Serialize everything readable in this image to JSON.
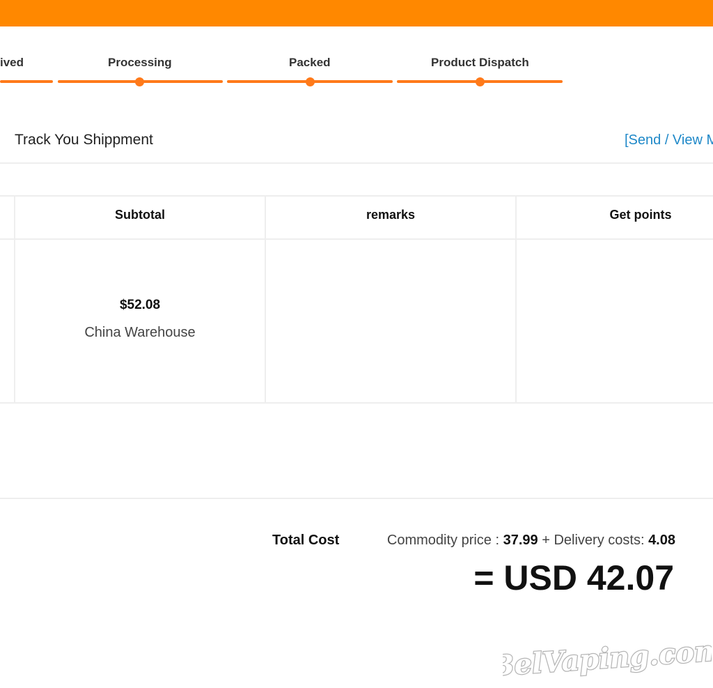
{
  "colors": {
    "accent": "#ff8800",
    "link": "#1e88c8"
  },
  "progress": {
    "steps": [
      {
        "label": "ived"
      },
      {
        "label": "Processing"
      },
      {
        "label": "Packed"
      },
      {
        "label": "Product Dispatch"
      }
    ]
  },
  "tracking": {
    "title": "Track You Shippment",
    "link_label": "[Send / View M"
  },
  "table": {
    "headers": [
      "Subtotal",
      "remarks",
      "Get points"
    ],
    "row": {
      "subtotal": "$52.08",
      "warehouse": "China Warehouse",
      "remarks": "",
      "points": ""
    }
  },
  "summary": {
    "label": "Total Cost",
    "commodity_label": "Commodity price :",
    "commodity_value": "37.99",
    "delivery_label": "+ Delivery costs:",
    "delivery_value": "4.08",
    "grand_total": "= USD 42.07"
  },
  "watermark": {
    "text": "BelVaping.com"
  }
}
